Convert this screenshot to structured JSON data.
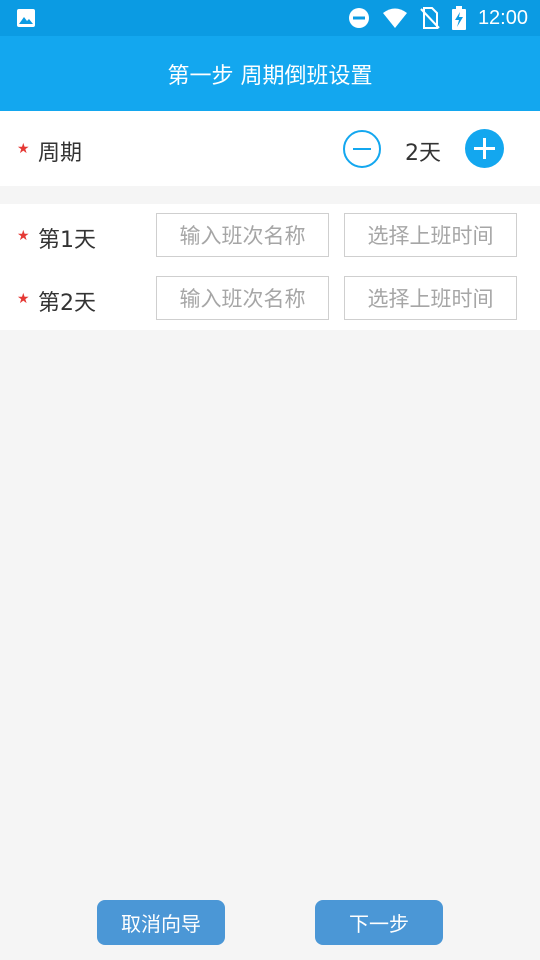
{
  "status_bar": {
    "time": "12:00",
    "icons": [
      "image-icon",
      "do-not-disturb-icon",
      "wifi-icon",
      "no-sim-icon",
      "battery-charging-icon"
    ]
  },
  "header": {
    "title": "第一步 周期倒班设置"
  },
  "period": {
    "label": "周期",
    "count_text": "2天",
    "required_mark": "★"
  },
  "days": [
    {
      "label": "第1天",
      "name_placeholder": "输入班次名称",
      "time_placeholder": "选择上班时间"
    },
    {
      "label": "第2天",
      "name_placeholder": "输入班次名称",
      "time_placeholder": "选择上班时间"
    }
  ],
  "footer": {
    "cancel_label": "取消向导",
    "next_label": "下一步"
  },
  "colors": {
    "status_bar": "#0b9be3",
    "app_bar": "#13a7ef",
    "button": "#4b97d6",
    "required": "#e53935"
  }
}
